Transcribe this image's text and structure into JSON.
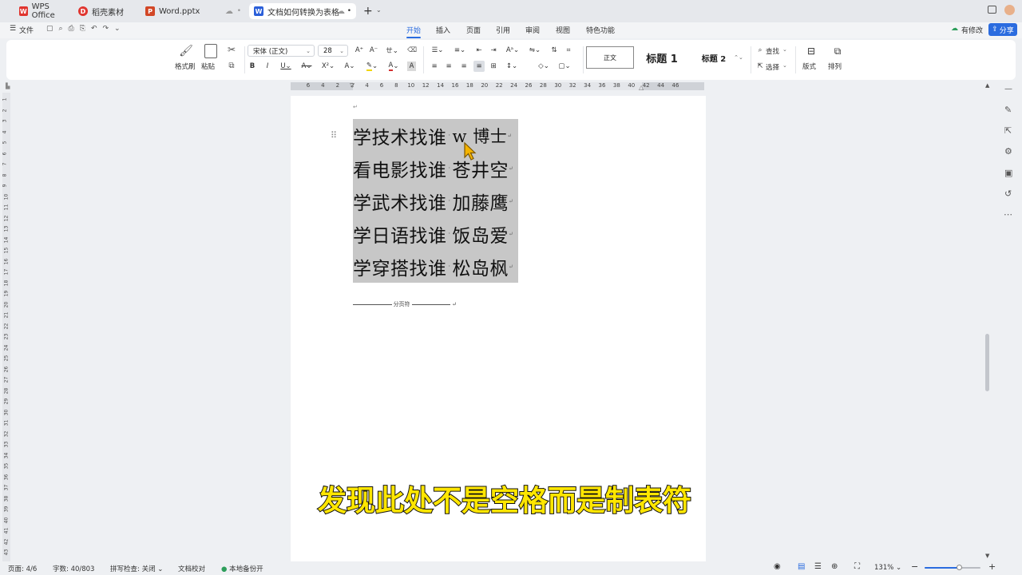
{
  "tabs": [
    {
      "label": "WPS Office",
      "icon": "wps-logo-icon"
    },
    {
      "label": "稻壳素材",
      "icon": "docer-icon"
    },
    {
      "label": "Word.pptx",
      "icon": "ppt-icon"
    },
    {
      "label": "文档如何转换为表格",
      "icon": "word-icon"
    }
  ],
  "menu": {
    "file": "文件",
    "tabs": [
      "开始",
      "插入",
      "页面",
      "引用",
      "审阅",
      "视图",
      "特色功能"
    ],
    "active": "开始",
    "has_changes": "有修改",
    "share": "分享"
  },
  "ribbon": {
    "format_painter": "格式刷",
    "paste": "粘贴",
    "font_name": "宋体 (正文)",
    "font_size": "28",
    "styles": [
      "正文",
      "标题 1",
      "标题 2"
    ],
    "find": "查找",
    "select": "选择",
    "layout": "版式",
    "arrange": "排列"
  },
  "ruler_numbers": [
    "6",
    "4",
    "2",
    "2",
    "4",
    "6",
    "8",
    "10",
    "12",
    "14",
    "16",
    "18",
    "20",
    "22",
    "24",
    "26",
    "28",
    "30",
    "32",
    "34",
    "36",
    "38",
    "40",
    "42",
    "44",
    "46"
  ],
  "vruler_numbers": [
    "1",
    "2",
    "3",
    "4",
    "5",
    "6",
    "7",
    "8",
    "9",
    "10",
    "11",
    "12",
    "13",
    "14",
    "15",
    "16",
    "17",
    "18",
    "19",
    "20",
    "21",
    "22",
    "23",
    "24",
    "25",
    "26",
    "27",
    "28",
    "29",
    "30",
    "31",
    "32",
    "33",
    "34",
    "35",
    "36",
    "37",
    "38",
    "39",
    "40",
    "41",
    "42",
    "43"
  ],
  "document": {
    "lines": [
      {
        "left": "学技术找谁",
        "right": "w 博士"
      },
      {
        "left": "看电影找谁",
        "right": "苍井空"
      },
      {
        "left": "学武术找谁",
        "right": "加藤鹰"
      },
      {
        "left": "学日语找谁",
        "right": "饭岛爱"
      },
      {
        "left": "学穿搭找谁",
        "right": "松岛枫"
      }
    ],
    "page_break": "分页符"
  },
  "caption": "发现此处不是空格而是制表符",
  "status": {
    "page": "页面: 4/6",
    "word_count": "字数: 40/803",
    "spell_check": "拼写检查: 关闭",
    "proofread": "文档校对",
    "backup": "本地备份开",
    "zoom": "131%",
    "zoom_level": 0.62
  },
  "colors": {
    "accent": "#2b6cdf",
    "wps_red": "#e0352f",
    "ppt_orange": "#d24726",
    "word_blue": "#2b5fd9",
    "caption_yellow": "#ffe600",
    "selection_gray": "#c7c7c7"
  }
}
